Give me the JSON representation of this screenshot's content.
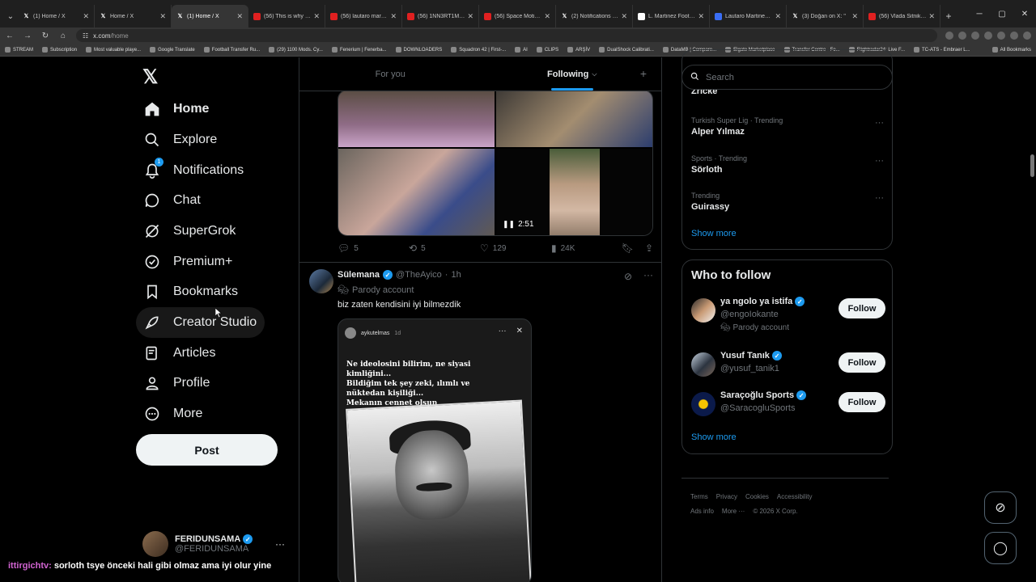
{
  "browser": {
    "tabs": [
      {
        "label": "(1) Home / X",
        "icon": "x"
      },
      {
        "label": "Home / X",
        "icon": "x"
      },
      {
        "label": "(1) Home / X",
        "icon": "x",
        "active": true
      },
      {
        "label": "(56) This is why Lautaro",
        "icon": "yt"
      },
      {
        "label": "(56) lautaro martinez",
        "icon": "yt"
      },
      {
        "label": "(56) 1NN3RT1ME | Ha",
        "icon": "yt"
      },
      {
        "label": "(56) Space Motion - A",
        "icon": "yt"
      },
      {
        "label": "(2) Notifications / X",
        "icon": "x"
      },
      {
        "label": "L. Martinez Football St",
        "icon": "d"
      },
      {
        "label": "Lautaro Martinez istat",
        "icon": "g"
      },
      {
        "label": "(3) Doğan on X: \"",
        "icon": "x"
      },
      {
        "label": "(56) Vlada Sitnikova B",
        "icon": "yt"
      }
    ],
    "url_host": "x.com",
    "url_path": "/home",
    "bookmarks": [
      "STREAM",
      "Subscription",
      "Most valuable playe...",
      "Google Translate",
      "Football Transfer Ru...",
      "(29) 1100 Mods. Cy...",
      "Fenerium | Fenerba...",
      "DOWNLOADERS",
      "Squadron 42 | First-...",
      "AI",
      "CLIPS",
      "ARŞİV",
      "DualShock Calibrati...",
      "DataMB | Compare...",
      "Elgato Marketplace",
      "Transfer Centre - Fo...",
      "Flightradar24: Live F...",
      "TC-ATS - Embraer L..."
    ],
    "all_bookmarks": "All Bookmarks"
  },
  "nav": {
    "items": [
      {
        "label": "Home",
        "icon": "home-icon",
        "bold": true
      },
      {
        "label": "Explore",
        "icon": "search-icon"
      },
      {
        "label": "Notifications",
        "icon": "bell-icon",
        "badge": "1"
      },
      {
        "label": "Chat",
        "icon": "chat-icon"
      },
      {
        "label": "SuperGrok",
        "icon": "grok-icon"
      },
      {
        "label": "Premium+",
        "icon": "premium-icon"
      },
      {
        "label": "Bookmarks",
        "icon": "bookmark-icon"
      },
      {
        "label": "Creator Studio",
        "icon": "rocket-icon"
      },
      {
        "label": "Articles",
        "icon": "articles-icon"
      },
      {
        "label": "Profile",
        "icon": "person-icon"
      },
      {
        "label": "More",
        "icon": "more-icon"
      }
    ],
    "post_label": "Post",
    "account": {
      "name": "FERIDUNSAMA",
      "handle": "@FERIDUNSAMA"
    }
  },
  "timeline": {
    "tabs": [
      "For you",
      "Following"
    ],
    "active_tab": "Following",
    "tweet1": {
      "video_duration": "2:51",
      "replies": "5",
      "reposts": "5",
      "likes": "129",
      "views": "24K"
    },
    "tweet2": {
      "name": "Sülemana",
      "handle": "@TheAyico",
      "time": "1h",
      "label": "Parody account",
      "text": "biz zaten kendisini iyi bilmezdik",
      "story_user": "aykutelmas",
      "story_time": "1d",
      "story_text": "Ne ideolosini bilirim, ne siyasi\nkimliğini...\nBildiğim tek şey zeki, ılımlı ve\nnüktedan kişiliği...\nMekanın cennet olsun"
    }
  },
  "sidebar": {
    "search_placeholder": "Search",
    "partial_trend": "Zricke",
    "trends": [
      {
        "meta": "Turkish Super Lig · Trending",
        "title": "Alper Yılmaz"
      },
      {
        "meta": "Sports · Trending",
        "title": "Sörloth"
      },
      {
        "meta": "Trending",
        "title": "Guirassy"
      }
    ],
    "show_more": "Show more",
    "who_to_follow": {
      "title": "Who to follow",
      "users": [
        {
          "name": "ya ngolo ya istifa",
          "handle": "@engoIokante",
          "label": "Parody account",
          "follow": "Follow"
        },
        {
          "name": "Yusuf Tanık",
          "handle": "@yusuf_tanik1",
          "follow": "Follow"
        },
        {
          "name": "Saraçoğlu Sports",
          "handle": "@SaracogluSports",
          "follow": "Follow"
        }
      ],
      "show_more": "Show more"
    },
    "footer": [
      "Terms",
      "Privacy",
      "Cookies",
      "Accessibility",
      "Ads info",
      "More ···",
      "© 2026 X Corp."
    ]
  },
  "chat_overlay": {
    "user": "ittirgichtv:",
    "message": "sorloth tsye önceki hali gibi olmaz ama iyi olur yine"
  },
  "colors": {
    "accent": "#1d9bf0",
    "background": "#000000",
    "border": "#2f3336",
    "muted": "#71767b",
    "text": "#e7e9ea"
  }
}
